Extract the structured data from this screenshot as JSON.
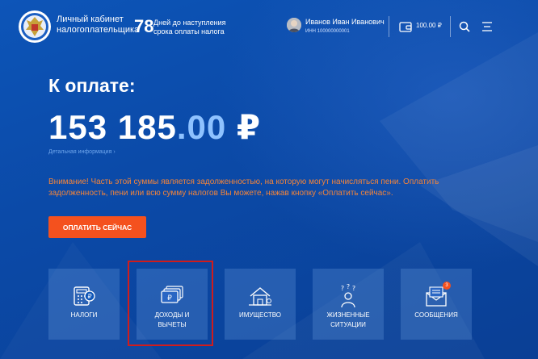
{
  "header": {
    "cabinet_title": "Личный кабинет налогоплательщика",
    "days_count": "78",
    "days_text": "Дней до наступления срока оплаты налога",
    "user_name": "Иванов Иван Иванович",
    "user_inn": "ИНН 100000000001",
    "balance": "100.00 ₽"
  },
  "payment": {
    "title": "К оплате:",
    "amount_main": "153 185",
    "amount_decimal": ".00",
    "currency": "₽",
    "detail_link": "Детальная информация ›",
    "warning": "Внимание! Часть этой суммы является задолженностью, на которую могут начисляться пени. Оплатить задолженность, пени или всю сумму налогов Вы можете, нажав кнопку «Оплатить сейчас».",
    "pay_button": "ОПЛАТИТЬ СЕЙЧАС"
  },
  "tiles": [
    {
      "line1": "НАЛОГИ",
      "line2": "",
      "icon": "calculator-icon"
    },
    {
      "line1": "ДОХОДЫ И",
      "line2": "ВЫЧЕТЫ",
      "icon": "money-cards-icon"
    },
    {
      "line1": "ИМУЩЕСТВО",
      "line2": "",
      "icon": "house-icon"
    },
    {
      "line1": "ЖИЗНЕННЫЕ",
      "line2": "СИТУАЦИИ",
      "icon": "people-question-icon"
    },
    {
      "line1": "СООБЩЕНИЯ",
      "line2": "",
      "icon": "envelope-icon",
      "badge": "3"
    }
  ],
  "colors": {
    "background": "#0b4aa8",
    "accent": "#f4511e",
    "warning_text": "#f3843a",
    "highlight_box": "#d01c1c"
  }
}
